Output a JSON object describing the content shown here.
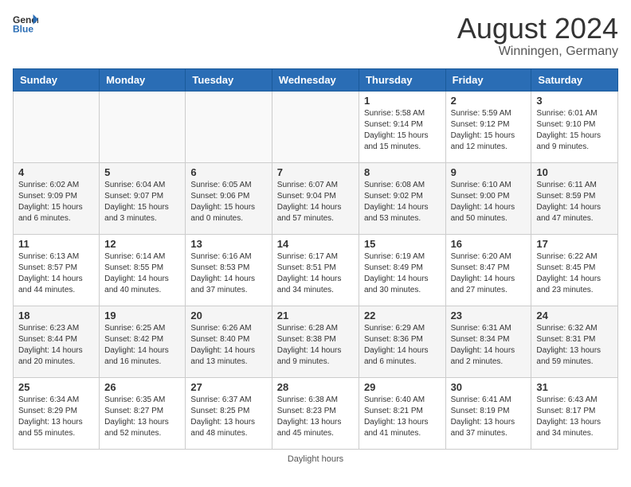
{
  "header": {
    "logo_general": "General",
    "logo_blue": "Blue",
    "title": "August 2024",
    "subtitle": "Winningen, Germany"
  },
  "days_of_week": [
    "Sunday",
    "Monday",
    "Tuesday",
    "Wednesday",
    "Thursday",
    "Friday",
    "Saturday"
  ],
  "weeks": [
    [
      {
        "day": "",
        "info": ""
      },
      {
        "day": "",
        "info": ""
      },
      {
        "day": "",
        "info": ""
      },
      {
        "day": "",
        "info": ""
      },
      {
        "day": "1",
        "info": "Sunrise: 5:58 AM\nSunset: 9:14 PM\nDaylight: 15 hours and 15 minutes."
      },
      {
        "day": "2",
        "info": "Sunrise: 5:59 AM\nSunset: 9:12 PM\nDaylight: 15 hours and 12 minutes."
      },
      {
        "day": "3",
        "info": "Sunrise: 6:01 AM\nSunset: 9:10 PM\nDaylight: 15 hours and 9 minutes."
      }
    ],
    [
      {
        "day": "4",
        "info": "Sunrise: 6:02 AM\nSunset: 9:09 PM\nDaylight: 15 hours and 6 minutes."
      },
      {
        "day": "5",
        "info": "Sunrise: 6:04 AM\nSunset: 9:07 PM\nDaylight: 15 hours and 3 minutes."
      },
      {
        "day": "6",
        "info": "Sunrise: 6:05 AM\nSunset: 9:06 PM\nDaylight: 15 hours and 0 minutes."
      },
      {
        "day": "7",
        "info": "Sunrise: 6:07 AM\nSunset: 9:04 PM\nDaylight: 14 hours and 57 minutes."
      },
      {
        "day": "8",
        "info": "Sunrise: 6:08 AM\nSunset: 9:02 PM\nDaylight: 14 hours and 53 minutes."
      },
      {
        "day": "9",
        "info": "Sunrise: 6:10 AM\nSunset: 9:00 PM\nDaylight: 14 hours and 50 minutes."
      },
      {
        "day": "10",
        "info": "Sunrise: 6:11 AM\nSunset: 8:59 PM\nDaylight: 14 hours and 47 minutes."
      }
    ],
    [
      {
        "day": "11",
        "info": "Sunrise: 6:13 AM\nSunset: 8:57 PM\nDaylight: 14 hours and 44 minutes."
      },
      {
        "day": "12",
        "info": "Sunrise: 6:14 AM\nSunset: 8:55 PM\nDaylight: 14 hours and 40 minutes."
      },
      {
        "day": "13",
        "info": "Sunrise: 6:16 AM\nSunset: 8:53 PM\nDaylight: 14 hours and 37 minutes."
      },
      {
        "day": "14",
        "info": "Sunrise: 6:17 AM\nSunset: 8:51 PM\nDaylight: 14 hours and 34 minutes."
      },
      {
        "day": "15",
        "info": "Sunrise: 6:19 AM\nSunset: 8:49 PM\nDaylight: 14 hours and 30 minutes."
      },
      {
        "day": "16",
        "info": "Sunrise: 6:20 AM\nSunset: 8:47 PM\nDaylight: 14 hours and 27 minutes."
      },
      {
        "day": "17",
        "info": "Sunrise: 6:22 AM\nSunset: 8:45 PM\nDaylight: 14 hours and 23 minutes."
      }
    ],
    [
      {
        "day": "18",
        "info": "Sunrise: 6:23 AM\nSunset: 8:44 PM\nDaylight: 14 hours and 20 minutes."
      },
      {
        "day": "19",
        "info": "Sunrise: 6:25 AM\nSunset: 8:42 PM\nDaylight: 14 hours and 16 minutes."
      },
      {
        "day": "20",
        "info": "Sunrise: 6:26 AM\nSunset: 8:40 PM\nDaylight: 14 hours and 13 minutes."
      },
      {
        "day": "21",
        "info": "Sunrise: 6:28 AM\nSunset: 8:38 PM\nDaylight: 14 hours and 9 minutes."
      },
      {
        "day": "22",
        "info": "Sunrise: 6:29 AM\nSunset: 8:36 PM\nDaylight: 14 hours and 6 minutes."
      },
      {
        "day": "23",
        "info": "Sunrise: 6:31 AM\nSunset: 8:34 PM\nDaylight: 14 hours and 2 minutes."
      },
      {
        "day": "24",
        "info": "Sunrise: 6:32 AM\nSunset: 8:31 PM\nDaylight: 13 hours and 59 minutes."
      }
    ],
    [
      {
        "day": "25",
        "info": "Sunrise: 6:34 AM\nSunset: 8:29 PM\nDaylight: 13 hours and 55 minutes."
      },
      {
        "day": "26",
        "info": "Sunrise: 6:35 AM\nSunset: 8:27 PM\nDaylight: 13 hours and 52 minutes."
      },
      {
        "day": "27",
        "info": "Sunrise: 6:37 AM\nSunset: 8:25 PM\nDaylight: 13 hours and 48 minutes."
      },
      {
        "day": "28",
        "info": "Sunrise: 6:38 AM\nSunset: 8:23 PM\nDaylight: 13 hours and 45 minutes."
      },
      {
        "day": "29",
        "info": "Sunrise: 6:40 AM\nSunset: 8:21 PM\nDaylight: 13 hours and 41 minutes."
      },
      {
        "day": "30",
        "info": "Sunrise: 6:41 AM\nSunset: 8:19 PM\nDaylight: 13 hours and 37 minutes."
      },
      {
        "day": "31",
        "info": "Sunrise: 6:43 AM\nSunset: 8:17 PM\nDaylight: 13 hours and 34 minutes."
      }
    ]
  ],
  "footer": {
    "label": "Daylight hours"
  }
}
